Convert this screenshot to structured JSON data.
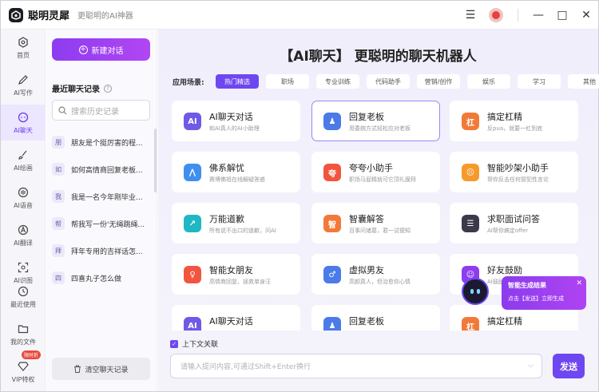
{
  "app": {
    "name": "聪明灵犀",
    "slogan": "更聪明的AI神器"
  },
  "titlebar": {
    "menu_icon": "hamburger-icon",
    "avatar_icon": "user-avatar",
    "minimize": "—",
    "maximize": "□",
    "close": "✕"
  },
  "nav": {
    "items": [
      {
        "label": "首页",
        "icon": "home-icon"
      },
      {
        "label": "AI写作",
        "icon": "pen-icon"
      },
      {
        "label": "AI聊天",
        "icon": "chat-icon",
        "active": true
      },
      {
        "label": "AI绘画",
        "icon": "brush-icon"
      },
      {
        "label": "AI语音",
        "icon": "voice-icon"
      },
      {
        "label": "AI翻译",
        "icon": "translate-icon"
      },
      {
        "label": "AI识图",
        "icon": "scan-icon"
      }
    ],
    "bottom": [
      {
        "label": "最近使用",
        "icon": "clock-icon"
      },
      {
        "label": "我的文件",
        "icon": "folder-icon"
      },
      {
        "label": "VIP特权",
        "icon": "diamond-icon",
        "badge": "限时折"
      }
    ]
  },
  "history": {
    "new_chat": "新建对话",
    "title": "最近聊天记录",
    "search_placeholder": "搜索历史记录",
    "items": [
      {
        "badge": "朋",
        "text": "朋友是个挺厉害的程..."
      },
      {
        "badge": "如",
        "text": "如何高情商回复老板..."
      },
      {
        "badge": "我",
        "text": "我是一名今年刚毕业..."
      },
      {
        "badge": "帮",
        "text": "帮我写一份'无绳跳绳..."
      },
      {
        "badge": "拜",
        "text": "拜年专用的吉祥话怎..."
      },
      {
        "badge": "四",
        "text": "四喜丸子怎么做"
      }
    ],
    "clear": "清空聊天记录"
  },
  "main": {
    "title": "【AI聊天】 更聪明的聊天机器人",
    "scene_label": "应用场景:",
    "tabs": [
      "热门精选",
      "职场",
      "专业训练",
      "代码助手",
      "营销/创作",
      "娱乐",
      "学习",
      "其他"
    ],
    "cards": [
      {
        "title": "AI聊天对话",
        "desc": "和AI真人的AI小助理",
        "icon": "AI",
        "color": "#6e5ae6"
      },
      {
        "title": "回复老板",
        "desc": "用委婉方式轻松应对老板",
        "icon": "♟",
        "color": "#4a7be8",
        "selected": true
      },
      {
        "title": "搞定杠精",
        "desc": "反pua，就要一杠到底",
        "icon": "杠",
        "color": "#f27a38"
      },
      {
        "title": "佛系解忧",
        "desc": "赛博佛祖在线解疑答惑",
        "icon": "⋀",
        "color": "#3e8ff0"
      },
      {
        "title": "夸夸小助手",
        "desc": "职场马屁精就可它顶礼膜拜",
        "icon": "夸",
        "color": "#f2553f"
      },
      {
        "title": "智能吵架小助手",
        "desc": "帮你反击任何冒犯性言论",
        "icon": "☹",
        "color": "#f59a2b"
      },
      {
        "title": "万能道歉",
        "desc": "所有说不出口的道歉，问AI",
        "icon": "↗",
        "color": "#20b7c4"
      },
      {
        "title": "智囊解答",
        "desc": "百事问诸葛，君一试便知",
        "icon": "智",
        "color": "#f27a38"
      },
      {
        "title": "求职面试问答",
        "desc": "AI帮你搞定offer",
        "icon": "☰",
        "color": "#3a3a4a"
      },
      {
        "title": "智能女朋友",
        "desc": "高情商回复，拯救单身汪",
        "icon": "♀",
        "color": "#f2553f"
      },
      {
        "title": "虚拟男友",
        "desc": "高颜真人，但治愈你心情",
        "icon": "♂",
        "color": "#4a7be8"
      },
      {
        "title": "好友鼓励",
        "desc": "AI鼓励",
        "icon": "☺",
        "color": "#8d3cf0"
      },
      {
        "title": "AI聊天对话",
        "desc": "",
        "icon": "AI",
        "color": "#6e5ae6"
      },
      {
        "title": "回复老板",
        "desc": "",
        "icon": "♟",
        "color": "#4a7be8"
      },
      {
        "title": "搞定杠精",
        "desc": "",
        "icon": "杠",
        "color": "#f27a38"
      }
    ],
    "tip": {
      "title": "智能生成结果",
      "desc": "点击【发送】立即生成"
    },
    "context_label": "上下文关联",
    "input_placeholder": "请输入提问内容,可通过Shift+Enter换行",
    "send": "发送"
  }
}
